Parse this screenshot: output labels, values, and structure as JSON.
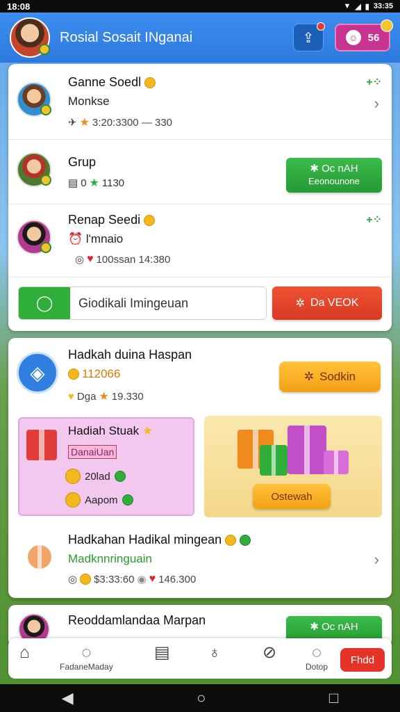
{
  "status": {
    "time": "18:08",
    "right": "33:35"
  },
  "header": {
    "title": "Rosial Sosait INganai",
    "coins": "56"
  },
  "friends": [
    {
      "name": "Ganne Soedl",
      "sub": "Monkse",
      "meta": "3:20:3300 — 330"
    },
    {
      "name": "Grup",
      "meta": "0",
      "meta2": "1130",
      "button_title": "Oc nAH",
      "button_sub": "Eeonounone"
    },
    {
      "name": "Renap Seedi",
      "sub": "l'mnaio",
      "meta": "100ssan 14:380"
    }
  ],
  "search": {
    "placeholder": "Giodikali Imingeuan",
    "value": "Giodikali Imingeuan",
    "button": "Da VEOK"
  },
  "rewards": {
    "title": "Hadkah duina Haspan",
    "coins": "112066",
    "meta_text": "Dga",
    "meta_value": "19.330",
    "button": "Sodkin",
    "daily": {
      "title": "Hadiah Stuak",
      "tag": "DanaiUan",
      "line1": "20lad",
      "line2": "Aapom"
    },
    "chest_button": "Ostewah",
    "item2": {
      "title": "Hadkahan Hadikal mingean",
      "sub": "Madknnringuain",
      "meta1": "$3:33:60",
      "meta2": "146.300"
    },
    "item3": {
      "title": "Reoddamlandaa Marpan",
      "button": "Oc nAH"
    }
  },
  "nav": {
    "label1": "FadaneMaday",
    "label2": "Dotop",
    "red": "Fhdd"
  },
  "colors": {
    "header": "#3d8ef0",
    "green": "#2fae3a",
    "orange": "#f3a016",
    "red": "#e53427",
    "pink": "#f2c8ef"
  }
}
